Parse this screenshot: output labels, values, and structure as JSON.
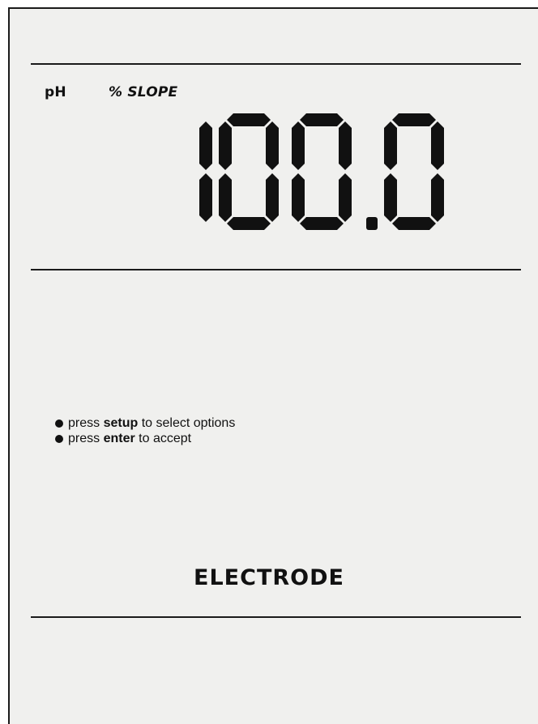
{
  "display": {
    "unit_label": "pH",
    "mode_label": "% SLOPE",
    "reading": "100.0",
    "colors": {
      "background": "#f0f0ee",
      "segment": "#111111",
      "rule": "#1a1a1a"
    }
  },
  "instructions": [
    {
      "prefix": "press ",
      "key": "setup",
      "suffix": " to select options",
      "icon": "bullet-icon"
    },
    {
      "prefix": "press ",
      "key": "enter",
      "suffix": " to accept",
      "icon": "bullet-icon"
    }
  ],
  "footer": {
    "title": "ELECTRODE"
  }
}
